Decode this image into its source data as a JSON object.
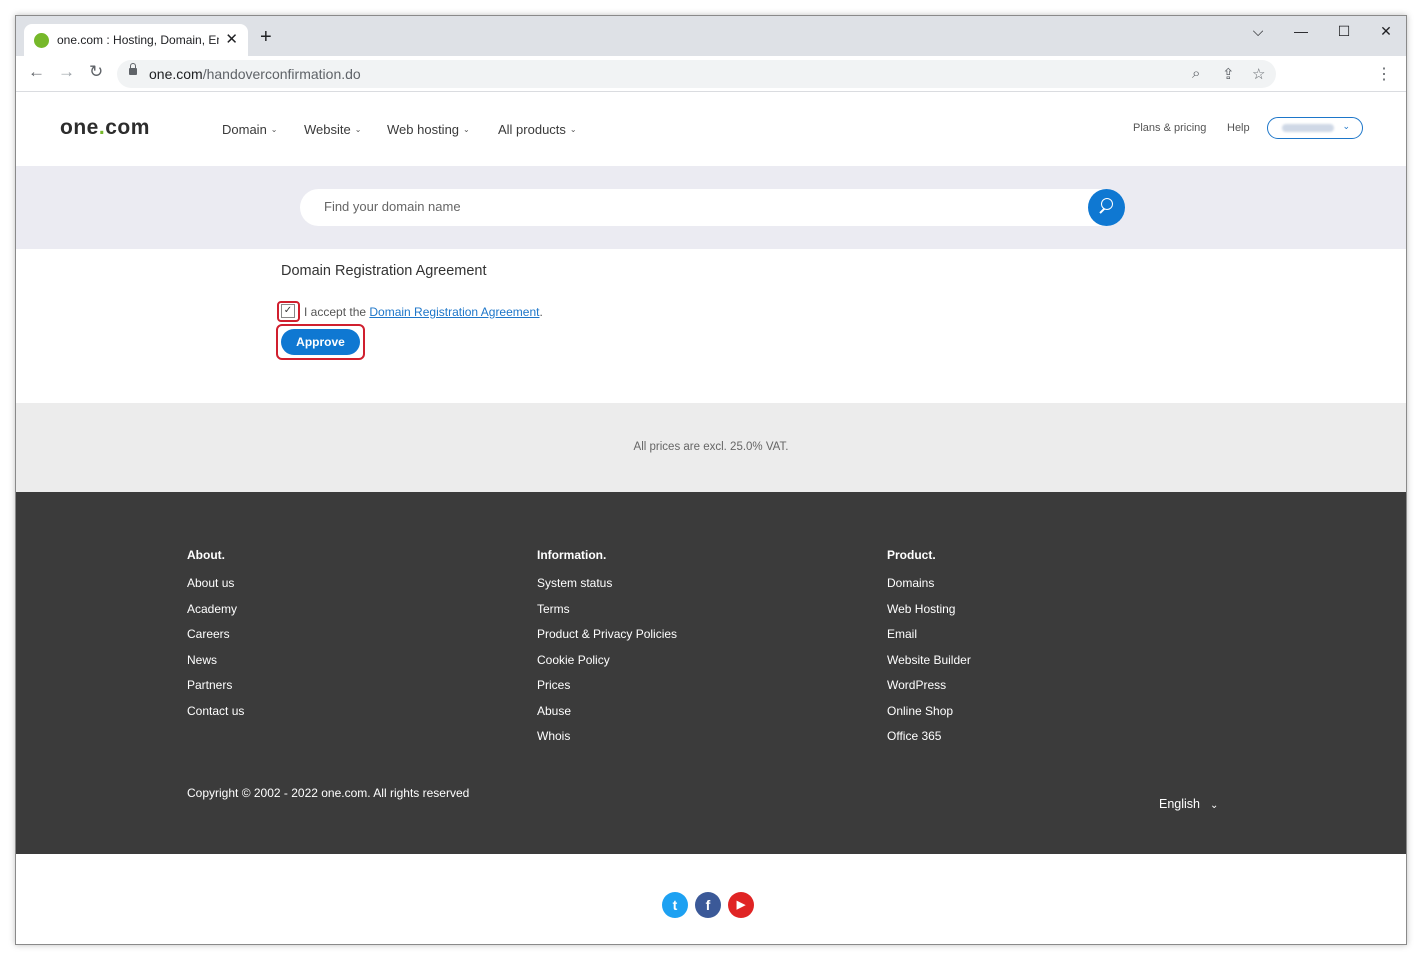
{
  "browser": {
    "tab_title": "one.com : Hosting, Domain, Email",
    "tab_close": "✕",
    "new_tab": "+",
    "url_domain": "one.com",
    "url_path": "/handoverconfirmation.do",
    "icons": {
      "back": "←",
      "forward": "→",
      "reload": "↻",
      "zoom": "⌕",
      "share": "⇪",
      "star": "☆",
      "menu": "⋮",
      "chevron": "⌵",
      "minimize": "—",
      "maximize": "☐",
      "close": "✕"
    }
  },
  "header": {
    "logo_main": "one",
    "logo_dot": ".",
    "logo_tld": "com",
    "nav": [
      {
        "label": "Domain"
      },
      {
        "label": "Website"
      },
      {
        "label": "Web hosting"
      },
      {
        "label": "All products"
      }
    ],
    "plans_label": "Plans & pricing",
    "help_label": "Help",
    "account_chevron": "⌄"
  },
  "search": {
    "placeholder": "Find your domain name"
  },
  "agreement": {
    "title": "Domain Registration Agreement",
    "checkbox_mark": "✓",
    "accept_prefix": "I accept the ",
    "accept_link": "Domain Registration Agreement",
    "accept_suffix": ".",
    "approve_label": "Approve"
  },
  "vat_note": "All prices are excl. 25.0% VAT.",
  "footer": {
    "columns": [
      {
        "heading": "About.",
        "links": [
          "About us",
          "Academy",
          "Careers",
          "News",
          "Partners",
          "Contact us"
        ]
      },
      {
        "heading": "Information.",
        "links": [
          "System status",
          "Terms",
          "Product & Privacy Policies",
          "Cookie Policy",
          "Prices",
          "Abuse",
          "Whois"
        ]
      },
      {
        "heading": "Product.",
        "links": [
          "Domains",
          "Web Hosting",
          "Email",
          "Website Builder",
          "WordPress",
          "Online Shop",
          "Office 365"
        ]
      }
    ],
    "copyright": "Copyright © 2002 - 2022 one.com. All rights reserved",
    "language": "English",
    "language_chevron": "⌄"
  },
  "social": {
    "twitter": {
      "glyph": "t",
      "color": "#1da1f2"
    },
    "facebook": {
      "glyph": "f",
      "color": "#3b5998"
    },
    "youtube": {
      "glyph": "▶",
      "color": "#e02424"
    }
  }
}
